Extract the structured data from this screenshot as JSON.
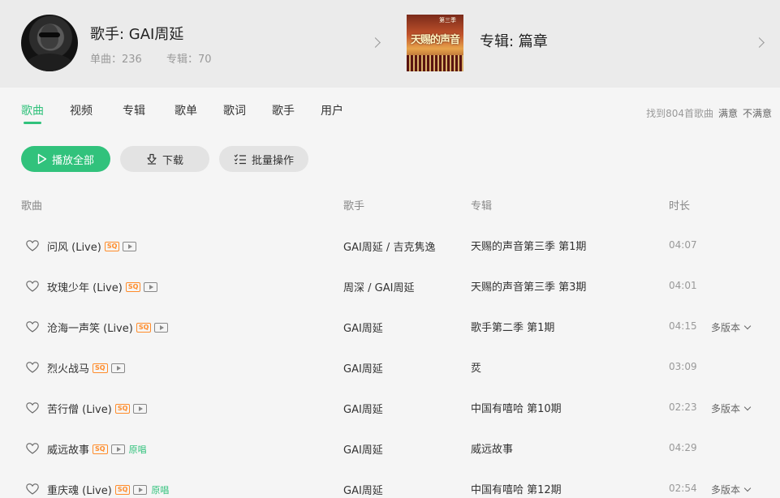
{
  "artist": {
    "title": "歌手: GAI周延",
    "singles": "单曲：236",
    "albums": "专辑：70"
  },
  "album_card": {
    "title": "专辑: 篇章",
    "cover_text": "天赐的声音",
    "cover_top": "第三季"
  },
  "tabs": [
    "歌曲",
    "视频",
    "专辑",
    "歌单",
    "歌词",
    "歌手",
    "用户"
  ],
  "result": {
    "found": "找到804首歌曲",
    "satisfied": "满意",
    "unsatisfied": "不满意"
  },
  "actions": {
    "play_all": "播放全部",
    "download": "下载",
    "batch": "批量操作"
  },
  "columns": {
    "song": "歌曲",
    "singer": "歌手",
    "album": "专辑",
    "duration": "时长"
  },
  "songs": [
    {
      "name": "问风 (Live)",
      "sq": "SQ",
      "singer": "GAI周延 / 吉克隽逸",
      "album": "天赐的声音第三季 第1期",
      "duration": "04:07"
    },
    {
      "name": "玫瑰少年 (Live)",
      "sq": "SQ",
      "singer": "周深 / GAI周延",
      "album": "天赐的声音第三季 第3期",
      "duration": "04:01"
    },
    {
      "name": "沧海一声笑 (Live)",
      "sq": "SQ",
      "singer": "GAI周延",
      "album": "歌手第二季 第1期",
      "duration": "04:15",
      "versions": "多版本"
    },
    {
      "name": "烈火战马",
      "sq": "SQ",
      "singer": "GAI周延",
      "album": "烎",
      "duration": "03:09"
    },
    {
      "name": "苦行僧 (Live)",
      "sq": "SQ",
      "singer": "GAI周延",
      "album": "中国有嘻哈 第10期",
      "duration": "02:23",
      "versions": "多版本"
    },
    {
      "name": "威远故事",
      "sq": "SQ",
      "original": "原唱",
      "singer": "GAI周延",
      "album": "威远故事",
      "duration": "04:29"
    },
    {
      "name": "重庆魂 (Live)",
      "sq": "SQ",
      "original": "原唱",
      "singer": "GAI周延",
      "album": "中国有嘻哈 第12期",
      "duration": "02:54",
      "versions": "多版本"
    }
  ],
  "colors": {
    "accent": "#31c27c",
    "sq_badge": "#ff8c2b",
    "header_bg": "#ebebeb",
    "page_bg": "#f5f5f5"
  }
}
